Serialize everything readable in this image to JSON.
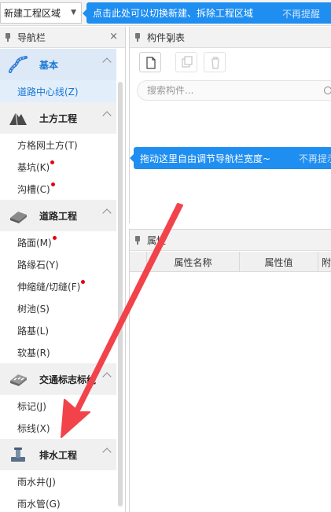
{
  "topbar": {
    "region_select_value": "新建工程区域",
    "tip_text": "点击此处可以切换新建、拆除工程区域",
    "tip_dismiss": "不再提醒"
  },
  "nav": {
    "title": "导航栏",
    "close_glyph": "×",
    "categories": [
      {
        "label": "基本",
        "icon": "road-centerline-icon",
        "items": [
          {
            "label": "道路中心线(Z)"
          }
        ]
      },
      {
        "label": "土方工程",
        "icon": "earthwork-icon",
        "items": [
          {
            "label": "方格网土方(T)"
          },
          {
            "label": "基坑(K)"
          },
          {
            "label": "沟槽(C)"
          }
        ]
      },
      {
        "label": "道路工程",
        "icon": "road-engineering-icon",
        "items": [
          {
            "label": "路面(M)"
          },
          {
            "label": "路缘石(Y)"
          },
          {
            "label": "伸缩缝/切缝(F)"
          },
          {
            "label": "树池(S)"
          },
          {
            "label": "路基(L)"
          },
          {
            "label": "软基(R)"
          }
        ]
      },
      {
        "label": "交通标志标线",
        "icon": "traffic-sign-icon",
        "items": [
          {
            "label": "标记(J)"
          },
          {
            "label": "标线(X)"
          }
        ]
      },
      {
        "label": "排水工程",
        "icon": "drainage-icon",
        "items": [
          {
            "label": "雨水井(J)"
          },
          {
            "label": "雨水管(G)"
          }
        ]
      }
    ]
  },
  "components": {
    "title": "构件列表",
    "search_placeholder": "搜索构件...",
    "drag_tip_text": "拖动这里自由调节导航栏宽度~",
    "drag_tip_dismiss": "不再提示"
  },
  "properties": {
    "title": "属性",
    "columns": {
      "name": "属性名称",
      "value": "属性值",
      "extra": "附"
    }
  },
  "colors": {
    "accent_blue": "#1f8ef1",
    "selected_text": "#1677d2",
    "new_badge_red": "#e50012",
    "annotation_arrow": "#f2434a"
  }
}
